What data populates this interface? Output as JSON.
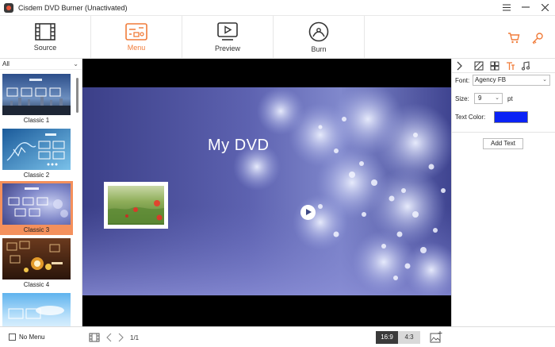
{
  "window": {
    "title": "Cisdem DVD Burner (Unactivated)",
    "controls": [
      "menu-icon",
      "minimize-icon",
      "close-icon"
    ]
  },
  "toolbar": {
    "tabs": [
      {
        "label": "Source",
        "icon": "film-icon",
        "active": false
      },
      {
        "label": "Menu",
        "icon": "menu-template-icon",
        "active": true
      },
      {
        "label": "Preview",
        "icon": "play-screen-icon",
        "active": false
      },
      {
        "label": "Burn",
        "icon": "disc-icon",
        "active": false
      }
    ],
    "right_icons": [
      "cart-icon",
      "key-icon"
    ]
  },
  "templates": {
    "filter": "All",
    "items": [
      {
        "caption": "Classic 1",
        "selected": false
      },
      {
        "caption": "Classic 2",
        "selected": false
      },
      {
        "caption": "Classic 3",
        "selected": true
      },
      {
        "caption": "Classic 4",
        "selected": false
      },
      {
        "caption": "",
        "selected": false
      }
    ]
  },
  "preview": {
    "menu_title": "My DVD",
    "play_button": "play-icon"
  },
  "text_panel": {
    "font_label": "Font:",
    "font_value": "Agency FB",
    "size_label": "Size:",
    "size_value": "9",
    "size_unit": "pt",
    "color_label": "Text Color:",
    "text_color": "#0a22f5",
    "add_text_label": "Add Text"
  },
  "bottom": {
    "no_menu_label": "No Menu",
    "page_indicator": "1/1",
    "ratio_options": [
      "16:9",
      "4:3"
    ],
    "ratio_selected": "16:9"
  },
  "colors": {
    "accent": "#f07c3a",
    "selected_bg": "#f4905c"
  }
}
